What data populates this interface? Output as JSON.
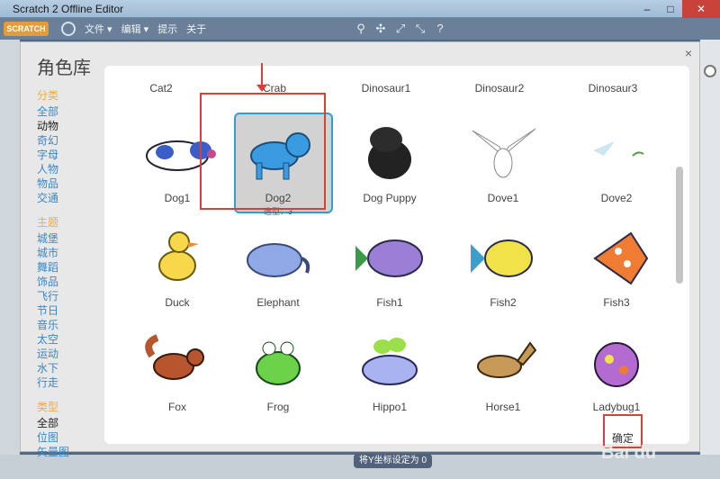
{
  "window": {
    "title": "Scratch 2 Offline Editor",
    "min": "–",
    "max": "□",
    "close": "✕"
  },
  "menubar": {
    "logo": "SCRATCH",
    "items": [
      "文件 ▾",
      "编辑 ▾",
      "提示",
      "关于"
    ]
  },
  "dialog": {
    "title": "角色库",
    "close": "×"
  },
  "categories": {
    "group1_title": "分类",
    "group1": [
      "全部",
      "动物",
      "奇幻",
      "字母",
      "人物",
      "物品",
      "交通"
    ],
    "group2_title": "主题",
    "group2": [
      "城堡",
      "城市",
      "舞蹈",
      "饰品",
      "飞行",
      "节日",
      "音乐",
      "太空",
      "运动",
      "水下",
      "行走"
    ],
    "group3_title": "类型",
    "group3": [
      "全部",
      "位图",
      "矢量图"
    ]
  },
  "top_row": [
    "Cat2",
    "Crab",
    "Dinosaur1",
    "Dinosaur2",
    "Dinosaur3"
  ],
  "sprites": [
    {
      "name": "Dog1",
      "color": "#ffffff"
    },
    {
      "name": "Dog2",
      "color": "#3a9be0",
      "info": "造型：3"
    },
    {
      "name": "Dog Puppy",
      "color": "#222222"
    },
    {
      "name": "Dove1",
      "color": "#ffffff"
    },
    {
      "name": "Dove2",
      "color": "#cfe5f2"
    },
    {
      "name": "Duck",
      "color": "#f7d84a"
    },
    {
      "name": "Elephant",
      "color": "#8fa8e6"
    },
    {
      "name": "Fish1",
      "color": "#9b7fd6"
    },
    {
      "name": "Fish2",
      "color": "#f2e24a"
    },
    {
      "name": "Fish3",
      "color": "#f07b32"
    },
    {
      "name": "Fox",
      "color": "#b7552f"
    },
    {
      "name": "Frog",
      "color": "#6bd24a"
    },
    {
      "name": "Hippo1",
      "color": "#a8b3f0"
    },
    {
      "name": "Horse1",
      "color": "#c79a5a"
    },
    {
      "name": "Ladybug1",
      "color": "#b36bd2"
    }
  ],
  "bottom_pill": "将Y坐标设定为 0",
  "ok_button": "确定",
  "watermark": "Bai du"
}
